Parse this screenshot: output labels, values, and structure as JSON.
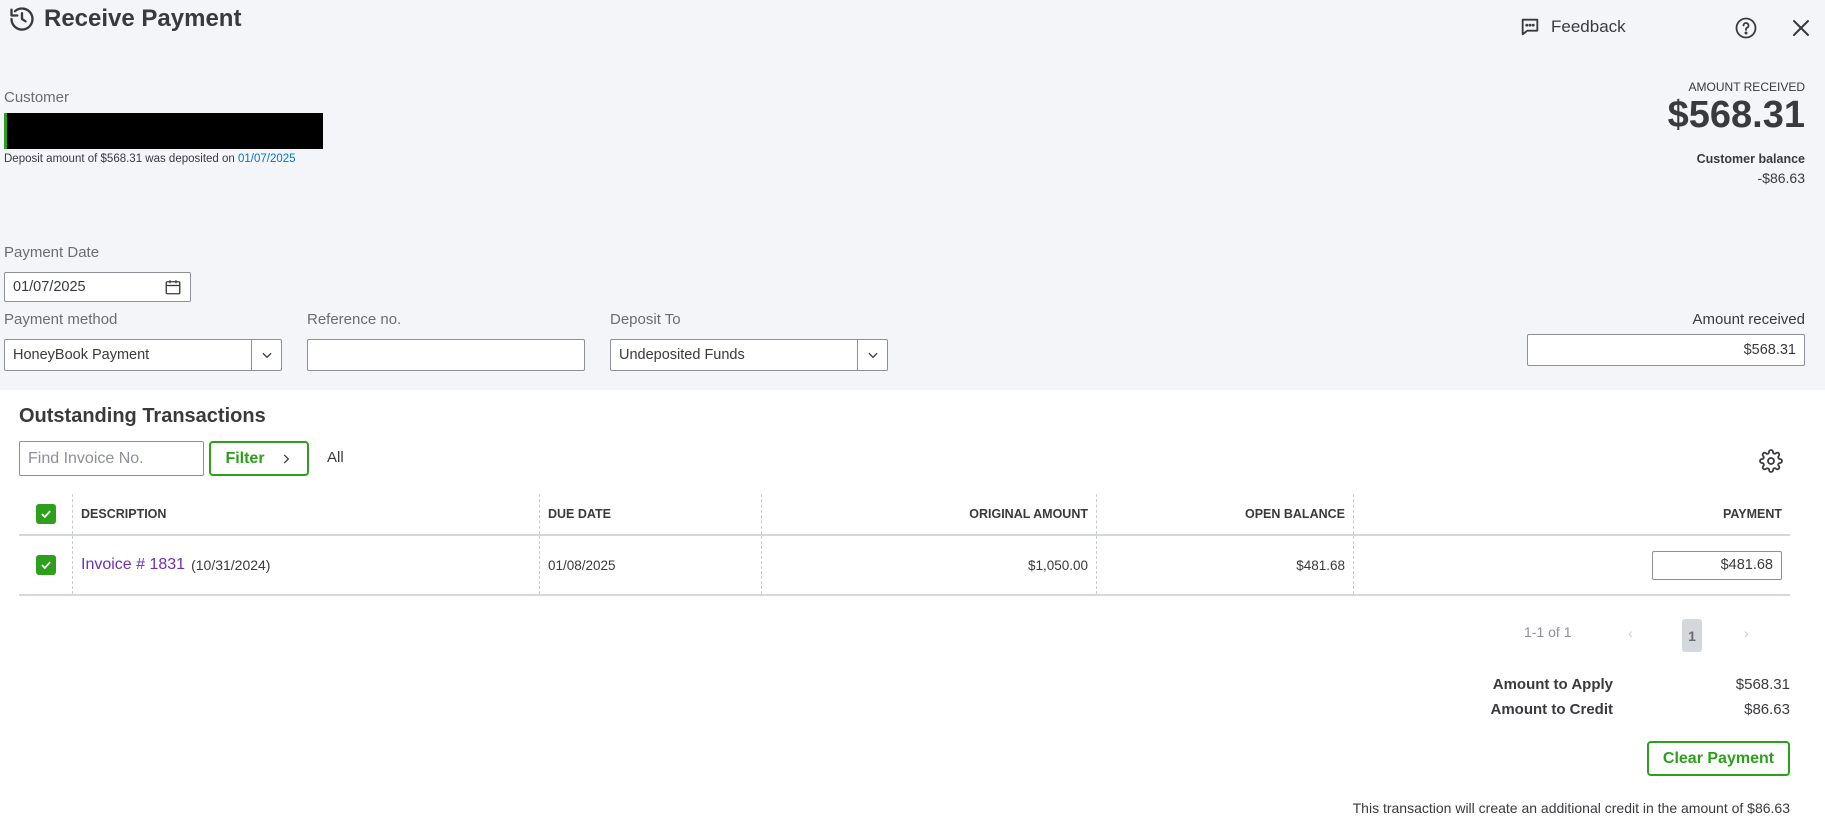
{
  "header": {
    "title": "Receive Payment",
    "feedback_label": "Feedback"
  },
  "customer": {
    "label": "Customer",
    "deposit_note_prefix": "Deposit amount of $568.31 was deposited on ",
    "deposit_note_date": "01/07/2025"
  },
  "summary": {
    "amount_received_label": "AMOUNT RECEIVED",
    "amount_received_value": "$568.31",
    "customer_balance_label": "Customer balance",
    "customer_balance_value": "-$86.63"
  },
  "form": {
    "payment_date_label": "Payment Date",
    "payment_date_value": "01/07/2025",
    "payment_method_label": "Payment method",
    "payment_method_value": "HoneyBook Payment",
    "reference_label": "Reference no.",
    "reference_value": "",
    "deposit_to_label": "Deposit To",
    "deposit_to_value": "Undeposited Funds",
    "amount_received_label": "Amount received",
    "amount_received_value": "$568.31"
  },
  "outstanding": {
    "title": "Outstanding Transactions",
    "find_placeholder": "Find Invoice No.",
    "filter_label": "Filter",
    "all_label": "All",
    "columns": [
      "DESCRIPTION",
      "DUE DATE",
      "ORIGINAL AMOUNT",
      "OPEN BALANCE",
      "PAYMENT"
    ],
    "rows": [
      {
        "checked": true,
        "invoice": "Invoice # 1831",
        "invoice_date": "(10/31/2024)",
        "due_date": "01/08/2025",
        "original_amount": "$1,050.00",
        "open_balance": "$481.68",
        "payment": "$481.68"
      }
    ]
  },
  "pagination": {
    "range": "1-1 of 1",
    "prev": "‹",
    "current": "1",
    "next": "›"
  },
  "totals": {
    "amount_to_apply_label": "Amount to Apply",
    "amount_to_apply_value": "$568.31",
    "amount_to_credit_label": "Amount to Credit",
    "amount_to_credit_value": "$86.63"
  },
  "clear_payment_label": "Clear Payment",
  "credit_note": "This transaction will create an additional credit in the amount of $86.63",
  "colors": {
    "accent_green": "#2ca01c",
    "link_purple": "#6b2ec5",
    "link_blue": "#0077c5",
    "header_bg": "#f4f5f8"
  },
  "icons": {
    "title": "history-icon",
    "feedback": "chat-bubble-icon",
    "help": "help-circle-icon",
    "close": "close-icon",
    "date": "calendar-icon",
    "settings": "gear-icon"
  }
}
